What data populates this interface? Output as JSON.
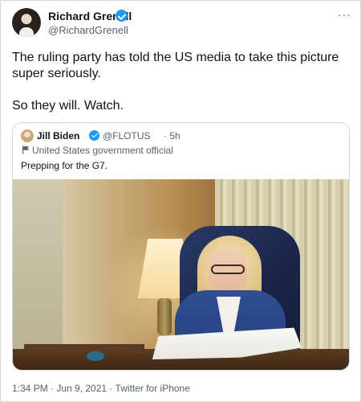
{
  "tweet": {
    "author": {
      "name": "Richard Grenell",
      "handle": "@RichardGrenell",
      "avatar_icon": "profile-photo",
      "verified_icon": "verified-badge-icon"
    },
    "more_label": "···",
    "text": "The ruling party has told the US media to take this picture super seriously.\n\nSo they will. Watch.",
    "quoted": {
      "author": {
        "name": "Jill Biden",
        "handle": "@FLOTUS",
        "avatar_icon": "profile-photo",
        "verified_icon": "verified-badge-icon"
      },
      "time": "· 5h",
      "label_icon": "flag-icon",
      "label": "United States government official",
      "text": "Prepping for the G7.",
      "photo_icon": "photo"
    },
    "meta": "1:34 PM · Jun 9, 2021 · Twitter for iPhone"
  },
  "colors": {
    "accent": "#1d9bf0",
    "text_primary": "#0f1419",
    "text_secondary": "#536471",
    "border": "#cfd9de"
  }
}
